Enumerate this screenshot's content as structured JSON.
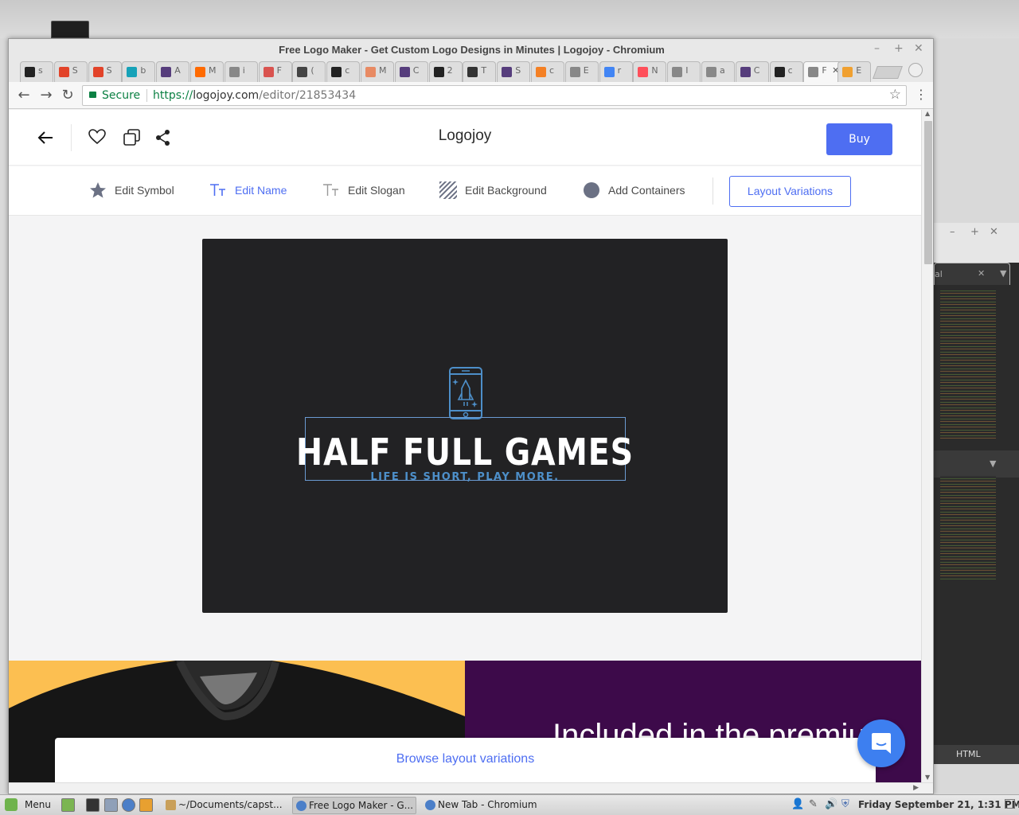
{
  "browser": {
    "window_title": "Free Logo Maker - Get Custom Logo Designs in Minutes | Logojoy - Chromium",
    "secure_label": "Secure",
    "url_protocol": "https://",
    "url_host": "logojoy.com",
    "url_path": "/editor/21853434",
    "tabs": [
      {
        "icon": "github-icon",
        "color": "#222222",
        "text": "s"
      },
      {
        "icon": "gitlab-icon",
        "color": "#e24329",
        "text": "S"
      },
      {
        "icon": "gitlab-icon",
        "color": "#e24329",
        "text": "S"
      },
      {
        "icon": "page-icon",
        "color": "#17a2b8",
        "text": "b"
      },
      {
        "icon": "bootstrap-icon",
        "color": "#563d7c",
        "text": "A"
      },
      {
        "icon": "asterisk-icon",
        "color": "#ff6a00",
        "text": "M"
      },
      {
        "icon": "document-icon",
        "color": "#888888",
        "text": "i"
      },
      {
        "icon": "s-icon",
        "color": "#d9534f",
        "text": "F"
      },
      {
        "icon": "book-icon",
        "color": "#444444",
        "text": "("
      },
      {
        "icon": "github-icon",
        "color": "#222222",
        "text": "c"
      },
      {
        "icon": "circle-icon",
        "color": "#e88a63",
        "text": "M"
      },
      {
        "icon": "bootstrap-icon",
        "color": "#563d7c",
        "text": "C"
      },
      {
        "icon": "f-icon",
        "color": "#222222",
        "text": "2"
      },
      {
        "icon": "codepen-icon",
        "color": "#333333",
        "text": "T"
      },
      {
        "icon": "bootstrap-icon",
        "color": "#563d7c",
        "text": "S"
      },
      {
        "icon": "stack-icon",
        "color": "#f48024",
        "text": "c"
      },
      {
        "icon": "document-icon",
        "color": "#888888",
        "text": "E"
      },
      {
        "icon": "google-icon",
        "color": "#4285f4",
        "text": "r"
      },
      {
        "icon": "m-icon",
        "color": "#ff4f5a",
        "text": "N"
      },
      {
        "icon": "document-icon",
        "color": "#888888",
        "text": "I"
      },
      {
        "icon": "document-icon",
        "color": "#888888",
        "text": "a"
      },
      {
        "icon": "bootstrap-icon",
        "color": "#563d7c",
        "text": "C"
      },
      {
        "icon": "github-icon",
        "color": "#222222",
        "text": "c"
      },
      {
        "icon": "logojoy-icon",
        "color": "#888888",
        "text": "F"
      },
      {
        "icon": "blogger-icon",
        "color": "#f0a030",
        "text": "E"
      }
    ]
  },
  "page": {
    "brand": "Logojoy",
    "buy_label": "Buy",
    "toolbar": {
      "edit_symbol": "Edit Symbol",
      "edit_name": "Edit Name",
      "edit_slogan": "Edit Slogan",
      "edit_background": "Edit Background",
      "add_containers": "Add Containers",
      "layout_variations": "Layout Variations"
    },
    "logo": {
      "name": "HALF FULL GAMES",
      "slogan": "LIFE IS SHORT, PLAY MORE.",
      "background_color": "#222224",
      "name_color": "#ffffff",
      "accent_color": "#4d8fc9"
    },
    "promo_text": "Included in the premium",
    "browse_label": "Browse layout variations",
    "accent_color": "#4e6ef2"
  },
  "background_window": {
    "tab_label": "al",
    "status": "HTML"
  },
  "taskbar": {
    "menu_label": "Menu",
    "windows": [
      {
        "label": "~/Documents/capst...",
        "icon": "folder-icon"
      },
      {
        "label": "Free Logo Maker - G...",
        "icon": "chromium-icon"
      },
      {
        "label": "New Tab - Chromium",
        "icon": "chromium-icon"
      }
    ],
    "clock": "Friday September 21,  1:31 PM"
  }
}
